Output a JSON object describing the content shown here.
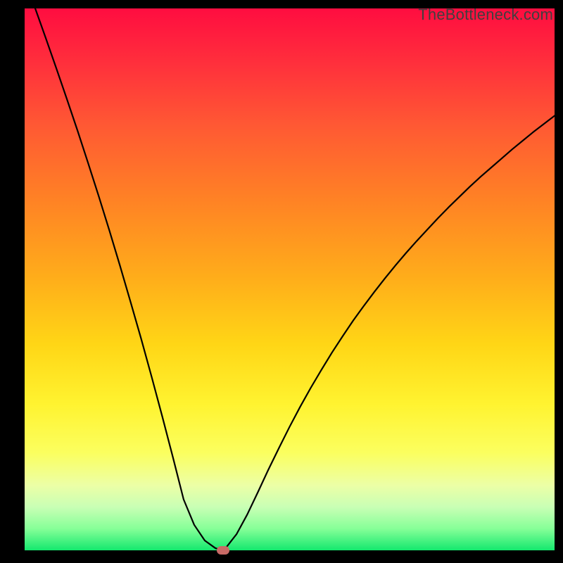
{
  "watermark": "TheBottleneck.com",
  "chart_data": {
    "type": "line",
    "title": "",
    "xlabel": "",
    "ylabel": "",
    "xlim": [
      0,
      100
    ],
    "ylim": [
      0,
      100
    ],
    "grid": false,
    "legend": false,
    "x": [
      0,
      2,
      4,
      6,
      8,
      10,
      12,
      14,
      16,
      18,
      20,
      22,
      24,
      26,
      28,
      30,
      32,
      34,
      36,
      37.4,
      38,
      40,
      42,
      44,
      46,
      48,
      50,
      52,
      54,
      56,
      58,
      60,
      62,
      64,
      66,
      68,
      70,
      72,
      74,
      76,
      78,
      80,
      82,
      84,
      86,
      88,
      90,
      92,
      94,
      96,
      98,
      100
    ],
    "y": [
      null,
      100,
      94.5,
      88.9,
      83.2,
      77.4,
      71.4,
      65.3,
      59.0,
      52.5,
      45.8,
      39.0,
      31.9,
      24.6,
      17.1,
      9.4,
      4.7,
      1.8,
      0.4,
      0.0,
      0.5,
      3.0,
      6.6,
      10.7,
      14.9,
      18.9,
      22.8,
      26.5,
      30.0,
      33.3,
      36.5,
      39.5,
      42.4,
      45.1,
      47.7,
      50.2,
      52.6,
      54.9,
      57.1,
      59.2,
      61.3,
      63.3,
      65.2,
      67.1,
      68.9,
      70.6,
      72.3,
      74.0,
      75.6,
      77.2,
      78.7,
      80.2
    ],
    "marker": {
      "x": 37.4,
      "y": 0.0,
      "color": "#c96a66"
    },
    "background_gradient": {
      "direction": "vertical",
      "stops": [
        {
          "pos": 0.0,
          "color": "#ff0d40"
        },
        {
          "pos": 0.1,
          "color": "#ff2f3c"
        },
        {
          "pos": 0.22,
          "color": "#ff5a33"
        },
        {
          "pos": 0.36,
          "color": "#ff8424"
        },
        {
          "pos": 0.5,
          "color": "#ffae1a"
        },
        {
          "pos": 0.62,
          "color": "#ffd616"
        },
        {
          "pos": 0.73,
          "color": "#fff330"
        },
        {
          "pos": 0.82,
          "color": "#fbff5f"
        },
        {
          "pos": 0.88,
          "color": "#ecffa6"
        },
        {
          "pos": 0.92,
          "color": "#c9ffb5"
        },
        {
          "pos": 0.96,
          "color": "#86ff98"
        },
        {
          "pos": 1.0,
          "color": "#14e86e"
        }
      ]
    }
  }
}
